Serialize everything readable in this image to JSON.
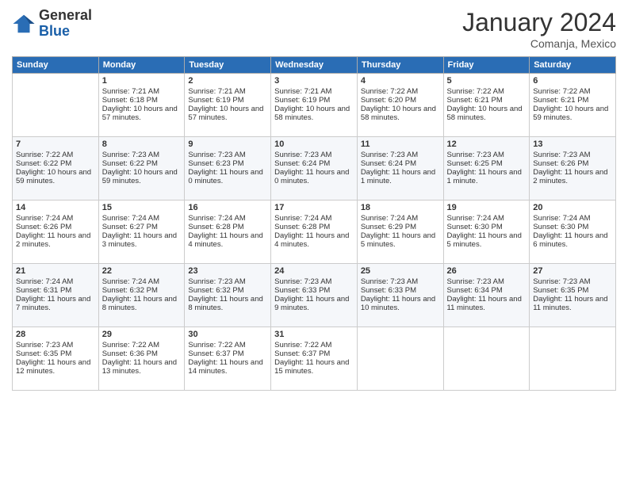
{
  "header": {
    "logo_general": "General",
    "logo_blue": "Blue",
    "month_title": "January 2024",
    "location": "Comanja, Mexico"
  },
  "days_of_week": [
    "Sunday",
    "Monday",
    "Tuesday",
    "Wednesday",
    "Thursday",
    "Friday",
    "Saturday"
  ],
  "weeks": [
    [
      {
        "day": "",
        "sunrise": "",
        "sunset": "",
        "daylight": ""
      },
      {
        "day": "1",
        "sunrise": "Sunrise: 7:21 AM",
        "sunset": "Sunset: 6:18 PM",
        "daylight": "Daylight: 10 hours and 57 minutes."
      },
      {
        "day": "2",
        "sunrise": "Sunrise: 7:21 AM",
        "sunset": "Sunset: 6:19 PM",
        "daylight": "Daylight: 10 hours and 57 minutes."
      },
      {
        "day": "3",
        "sunrise": "Sunrise: 7:21 AM",
        "sunset": "Sunset: 6:19 PM",
        "daylight": "Daylight: 10 hours and 58 minutes."
      },
      {
        "day": "4",
        "sunrise": "Sunrise: 7:22 AM",
        "sunset": "Sunset: 6:20 PM",
        "daylight": "Daylight: 10 hours and 58 minutes."
      },
      {
        "day": "5",
        "sunrise": "Sunrise: 7:22 AM",
        "sunset": "Sunset: 6:21 PM",
        "daylight": "Daylight: 10 hours and 58 minutes."
      },
      {
        "day": "6",
        "sunrise": "Sunrise: 7:22 AM",
        "sunset": "Sunset: 6:21 PM",
        "daylight": "Daylight: 10 hours and 59 minutes."
      }
    ],
    [
      {
        "day": "7",
        "sunrise": "Sunrise: 7:22 AM",
        "sunset": "Sunset: 6:22 PM",
        "daylight": "Daylight: 10 hours and 59 minutes."
      },
      {
        "day": "8",
        "sunrise": "Sunrise: 7:23 AM",
        "sunset": "Sunset: 6:22 PM",
        "daylight": "Daylight: 10 hours and 59 minutes."
      },
      {
        "day": "9",
        "sunrise": "Sunrise: 7:23 AM",
        "sunset": "Sunset: 6:23 PM",
        "daylight": "Daylight: 11 hours and 0 minutes."
      },
      {
        "day": "10",
        "sunrise": "Sunrise: 7:23 AM",
        "sunset": "Sunset: 6:24 PM",
        "daylight": "Daylight: 11 hours and 0 minutes."
      },
      {
        "day": "11",
        "sunrise": "Sunrise: 7:23 AM",
        "sunset": "Sunset: 6:24 PM",
        "daylight": "Daylight: 11 hours and 1 minute."
      },
      {
        "day": "12",
        "sunrise": "Sunrise: 7:23 AM",
        "sunset": "Sunset: 6:25 PM",
        "daylight": "Daylight: 11 hours and 1 minute."
      },
      {
        "day": "13",
        "sunrise": "Sunrise: 7:23 AM",
        "sunset": "Sunset: 6:26 PM",
        "daylight": "Daylight: 11 hours and 2 minutes."
      }
    ],
    [
      {
        "day": "14",
        "sunrise": "Sunrise: 7:24 AM",
        "sunset": "Sunset: 6:26 PM",
        "daylight": "Daylight: 11 hours and 2 minutes."
      },
      {
        "day": "15",
        "sunrise": "Sunrise: 7:24 AM",
        "sunset": "Sunset: 6:27 PM",
        "daylight": "Daylight: 11 hours and 3 minutes."
      },
      {
        "day": "16",
        "sunrise": "Sunrise: 7:24 AM",
        "sunset": "Sunset: 6:28 PM",
        "daylight": "Daylight: 11 hours and 4 minutes."
      },
      {
        "day": "17",
        "sunrise": "Sunrise: 7:24 AM",
        "sunset": "Sunset: 6:28 PM",
        "daylight": "Daylight: 11 hours and 4 minutes."
      },
      {
        "day": "18",
        "sunrise": "Sunrise: 7:24 AM",
        "sunset": "Sunset: 6:29 PM",
        "daylight": "Daylight: 11 hours and 5 minutes."
      },
      {
        "day": "19",
        "sunrise": "Sunrise: 7:24 AM",
        "sunset": "Sunset: 6:30 PM",
        "daylight": "Daylight: 11 hours and 5 minutes."
      },
      {
        "day": "20",
        "sunrise": "Sunrise: 7:24 AM",
        "sunset": "Sunset: 6:30 PM",
        "daylight": "Daylight: 11 hours and 6 minutes."
      }
    ],
    [
      {
        "day": "21",
        "sunrise": "Sunrise: 7:24 AM",
        "sunset": "Sunset: 6:31 PM",
        "daylight": "Daylight: 11 hours and 7 minutes."
      },
      {
        "day": "22",
        "sunrise": "Sunrise: 7:24 AM",
        "sunset": "Sunset: 6:32 PM",
        "daylight": "Daylight: 11 hours and 8 minutes."
      },
      {
        "day": "23",
        "sunrise": "Sunrise: 7:23 AM",
        "sunset": "Sunset: 6:32 PM",
        "daylight": "Daylight: 11 hours and 8 minutes."
      },
      {
        "day": "24",
        "sunrise": "Sunrise: 7:23 AM",
        "sunset": "Sunset: 6:33 PM",
        "daylight": "Daylight: 11 hours and 9 minutes."
      },
      {
        "day": "25",
        "sunrise": "Sunrise: 7:23 AM",
        "sunset": "Sunset: 6:33 PM",
        "daylight": "Daylight: 11 hours and 10 minutes."
      },
      {
        "day": "26",
        "sunrise": "Sunrise: 7:23 AM",
        "sunset": "Sunset: 6:34 PM",
        "daylight": "Daylight: 11 hours and 11 minutes."
      },
      {
        "day": "27",
        "sunrise": "Sunrise: 7:23 AM",
        "sunset": "Sunset: 6:35 PM",
        "daylight": "Daylight: 11 hours and 11 minutes."
      }
    ],
    [
      {
        "day": "28",
        "sunrise": "Sunrise: 7:23 AM",
        "sunset": "Sunset: 6:35 PM",
        "daylight": "Daylight: 11 hours and 12 minutes."
      },
      {
        "day": "29",
        "sunrise": "Sunrise: 7:22 AM",
        "sunset": "Sunset: 6:36 PM",
        "daylight": "Daylight: 11 hours and 13 minutes."
      },
      {
        "day": "30",
        "sunrise": "Sunrise: 7:22 AM",
        "sunset": "Sunset: 6:37 PM",
        "daylight": "Daylight: 11 hours and 14 minutes."
      },
      {
        "day": "31",
        "sunrise": "Sunrise: 7:22 AM",
        "sunset": "Sunset: 6:37 PM",
        "daylight": "Daylight: 11 hours and 15 minutes."
      },
      {
        "day": "",
        "sunrise": "",
        "sunset": "",
        "daylight": ""
      },
      {
        "day": "",
        "sunrise": "",
        "sunset": "",
        "daylight": ""
      },
      {
        "day": "",
        "sunrise": "",
        "sunset": "",
        "daylight": ""
      }
    ]
  ]
}
